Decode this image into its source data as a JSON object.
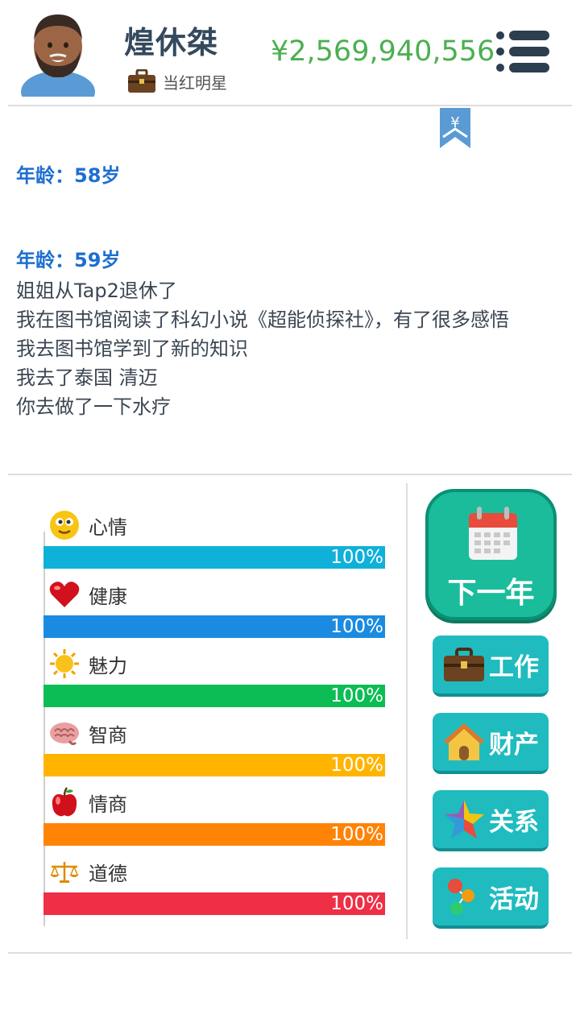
{
  "header": {
    "player_name": "煌休桀",
    "job": "当红明星",
    "money": "¥2,569,940,556"
  },
  "bookmark": {
    "symbol": "¥"
  },
  "log": {
    "ages": [
      {
        "heading": "年龄：58岁",
        "entries": []
      },
      {
        "heading": "年龄：59岁",
        "entries": [
          "姐姐从Tap2退休了",
          "我在图书馆阅读了科幻小说《超能侦探社》，有了很多感悟",
          "我去图书馆学到了新的知识",
          "我去了泰国 清迈",
          "你去做了一下水疗"
        ]
      }
    ]
  },
  "stats": [
    {
      "label": "心情",
      "value": "100%",
      "level": 1.0,
      "color": "#0fb1d9",
      "icon": "smiley-icon"
    },
    {
      "label": "健康",
      "value": "100%",
      "level": 1.0,
      "color": "#1a8be0",
      "icon": "heart-icon"
    },
    {
      "label": "魅力",
      "value": "100%",
      "level": 1.0,
      "color": "#0cbd53",
      "icon": "sun-icon"
    },
    {
      "label": "智商",
      "value": "100%",
      "level": 1.0,
      "color": "#ffb400",
      "icon": "brain-icon"
    },
    {
      "label": "情商",
      "value": "100%",
      "level": 1.0,
      "color": "#ff8305",
      "icon": "apple-icon"
    },
    {
      "label": "道德",
      "value": "100%",
      "level": 1.0,
      "color": "#ef2f45",
      "icon": "scales-icon"
    }
  ],
  "actions": {
    "next_year": "下一年",
    "work": "工作",
    "assets": "财产",
    "relations": "关系",
    "activities": "活动"
  },
  "colors": {
    "money": "#4caf50",
    "age_heading": "#1e6fd0",
    "primary_button": "#1abc9c",
    "action_button": "#1fbbbf"
  }
}
